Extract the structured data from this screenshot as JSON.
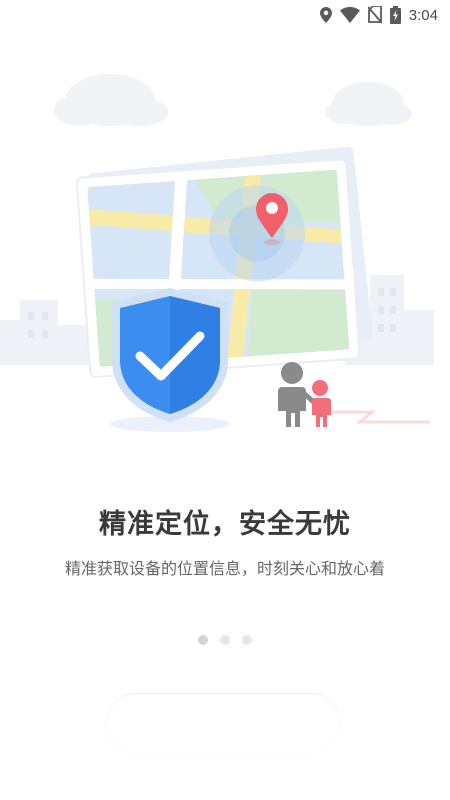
{
  "status_bar": {
    "time": "3:04",
    "icons": [
      "location-icon",
      "wifi-icon",
      "no-sim-icon",
      "battery-charging-icon"
    ]
  },
  "illustration": {
    "icons": [
      "map-icon",
      "location-pin-icon",
      "shield-check-icon",
      "people-walking-icon",
      "cloud-icon",
      "city-skyline-icon"
    ],
    "colors": {
      "shield": "#3b8ef0",
      "pin": "#f0616a",
      "map_green": "#cfe8c9",
      "map_blue": "#cfe1f7",
      "road": "#f5e8a8",
      "child": "#f36e7a",
      "adult": "#8a8a8a"
    }
  },
  "onboarding": {
    "title": "精准定位，安全无忧",
    "subtitle": "精准获取设备的位置信息，时刻关心和放心着",
    "page_count": 3,
    "active_page": 1
  },
  "start_button": {
    "label": ""
  }
}
